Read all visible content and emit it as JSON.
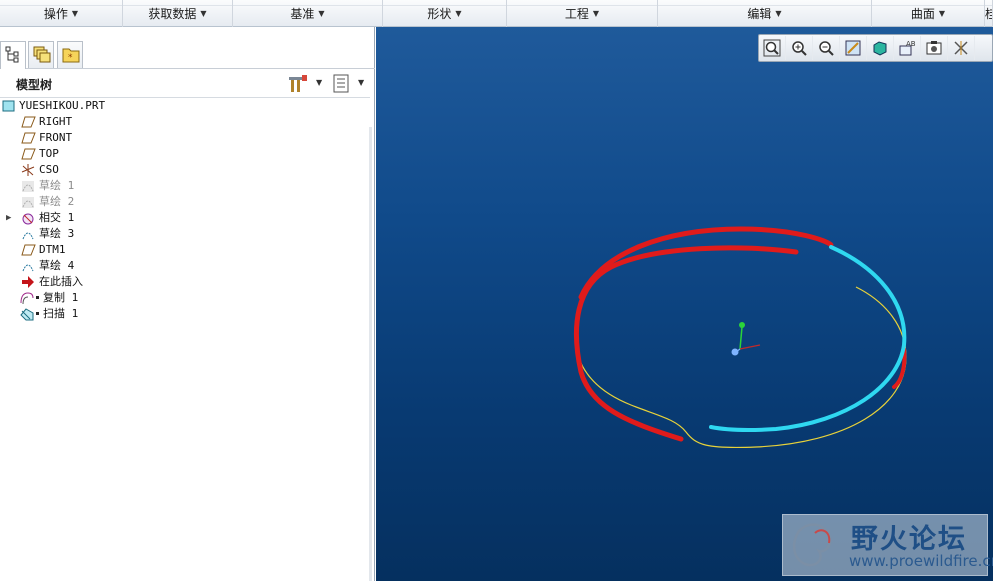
{
  "ribbon": {
    "groups": [
      {
        "label": "操作"
      },
      {
        "label": "获取数据"
      },
      {
        "label": "基准"
      },
      {
        "label": "形状"
      },
      {
        "label": "工程"
      },
      {
        "label": "编辑"
      },
      {
        "label": "曲面"
      },
      {
        "label": "桂"
      }
    ]
  },
  "panel_tabs": [
    {
      "icon": "model-tree-tab-icon"
    },
    {
      "icon": "layers-tab-icon"
    },
    {
      "icon": "favorites-tab-icon"
    }
  ],
  "model_tree": {
    "title": "模型树",
    "settings_icon": "tree-settings-icon",
    "filter_icon": "tree-filters-icon",
    "nodes": [
      {
        "label": "YUESHIKOU.PRT",
        "icon": "part-icon",
        "dim": false
      },
      {
        "label": "RIGHT",
        "icon": "datum-plane-icon",
        "dim": false
      },
      {
        "label": "FRONT",
        "icon": "datum-plane-icon",
        "dim": false
      },
      {
        "label": "TOP",
        "icon": "datum-plane-icon",
        "dim": false
      },
      {
        "label": "CSO",
        "icon": "coordinate-system-icon",
        "dim": false
      },
      {
        "label": "草绘 1",
        "icon": "sketch-icon",
        "dim": true
      },
      {
        "label": "草绘 2",
        "icon": "sketch-icon",
        "dim": true
      },
      {
        "label": "相交 1",
        "icon": "intersect-icon",
        "dim": false,
        "expandable": true
      },
      {
        "label": "草绘 3",
        "icon": "sketch-icon",
        "dim": false
      },
      {
        "label": "DTM1",
        "icon": "datum-plane-icon",
        "dim": false
      },
      {
        "label": "草绘 4",
        "icon": "sketch-icon",
        "dim": false
      },
      {
        "label": "在此插入",
        "icon": "insert-here-arrow-icon",
        "dim": false
      },
      {
        "label": "复制 1",
        "icon": "copy-feature-icon",
        "dim": false,
        "marked": true
      },
      {
        "label": "扫描 1",
        "icon": "sweep-feature-icon",
        "dim": false,
        "marked": true
      }
    ]
  },
  "view_toolbar": [
    {
      "icon": "refit-icon"
    },
    {
      "icon": "zoom-in-icon"
    },
    {
      "icon": "zoom-out-icon"
    },
    {
      "icon": "repaint-icon"
    },
    {
      "icon": "display-style-icon"
    },
    {
      "icon": "saved-orientations-icon"
    },
    {
      "icon": "view-manager-icon"
    },
    {
      "icon": "datum-display-filters-icon"
    }
  ],
  "watermark": {
    "name": "野火论坛",
    "url": "www.proewildfire.cn"
  },
  "colors": {
    "viewport_top": "#1f5a9b",
    "viewport_bottom": "#05305f",
    "curve_red": "#e01b1b",
    "curve_cyan": "#2fd8f0",
    "curve_yellow": "#e8d23a"
  }
}
